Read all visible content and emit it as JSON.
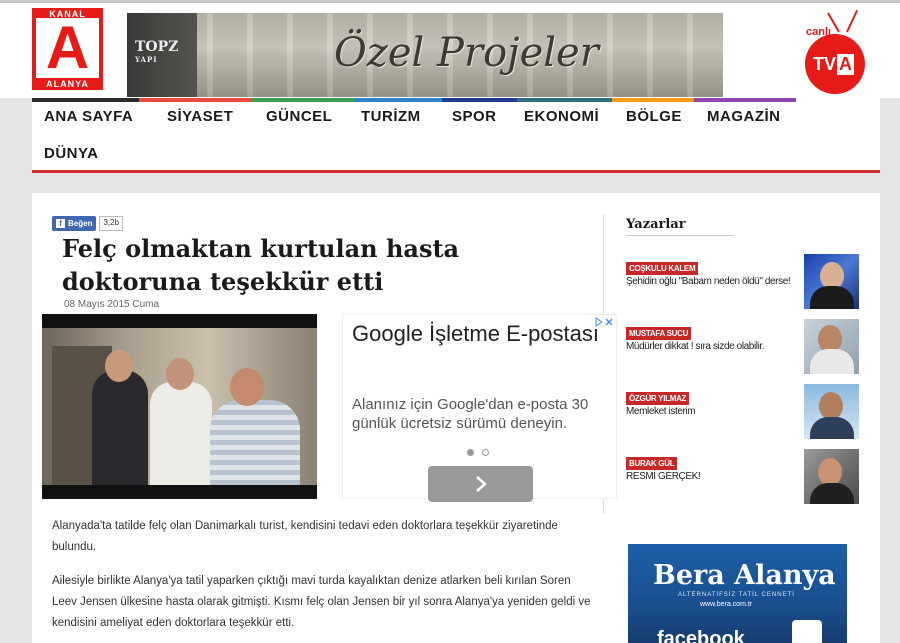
{
  "logo": {
    "top": "KANAL",
    "letter": "A",
    "bottom": "ALANYA"
  },
  "banner": {
    "brand": "TOP YAPI",
    "brand_top": "TOPZ",
    "brand_sub": "YAPI",
    "title": "Özel Projeler"
  },
  "live_tv": {
    "word": "canlı",
    "tv": "TV",
    "tv_letter": "A"
  },
  "nav": {
    "items": [
      "ANA SAYFA",
      "SİYASET",
      "GÜNCEL",
      "TURİZM",
      "SPOR",
      "EKONOMİ",
      "BÖLGE",
      "MAGAZİN",
      "DÜNYA"
    ],
    "colors": {
      "ana_sayfa": "#2c2c2c",
      "siyaset": "#e74c3c",
      "guncel": "#3a9d4b",
      "turizm": "#2f80c8",
      "spor": "#1e3c8f",
      "ekonomi": "#2f6e7a",
      "bolge": "#f39c12",
      "magazin": "#8e44ad",
      "accent": "#d32f2f"
    }
  },
  "article": {
    "like_label": "Beğen",
    "like_count": "3,2b",
    "headline": "Felç olmaktan kurtulan hasta doktoruna teşekkür etti",
    "date": "08 Mayıs 2015 Cuma",
    "paragraphs": [
      "Alanyada'ta tatilde felç olan Danimarkalı turist, kendisini tedavi eden doktorlara teşekkür ziyaretinde bulundu.",
      "Ailesiyle birlikte Alanya'ya tatil yaparken çıktığı mavi turda kayalıktan denize atlarken beli kırılan Soren Leev Jensen ülkesine hasta olarak gitmişti. Kısmı felç olan Jensen bir yıl sonra Alanya'ya yeniden geldi ve kendisini ameliyat eden doktorlara teşekkür etti."
    ]
  },
  "ad": {
    "title": "Google İşletme E-postası",
    "description": "Alanınız için Google'dan e-posta 30 günlük ücretsiz sürümü deneyin.",
    "next_icon": "chevron-right-icon"
  },
  "writers": {
    "heading": "Yazarlar",
    "items": [
      {
        "name": "COŞKULU KALEM",
        "title": "Şehidin oğlu \"Babam neden öldü\" derse!"
      },
      {
        "name": "MUSTAFA SUCU",
        "title": "Müdürler dikkat ! sıra sizde olabilir."
      },
      {
        "name": "ÖZGÜR YILMAZ",
        "title": "Memleket isterim"
      },
      {
        "name": "BURAK GÜL",
        "title": "RESMİ GERÇEK!"
      }
    ]
  },
  "bera_ad": {
    "name": "Bera Alanya",
    "tagline": "ALTERNATİFSİZ TATİL CENNETİ",
    "url": "www.bera.com.tr",
    "social": "facebook"
  }
}
